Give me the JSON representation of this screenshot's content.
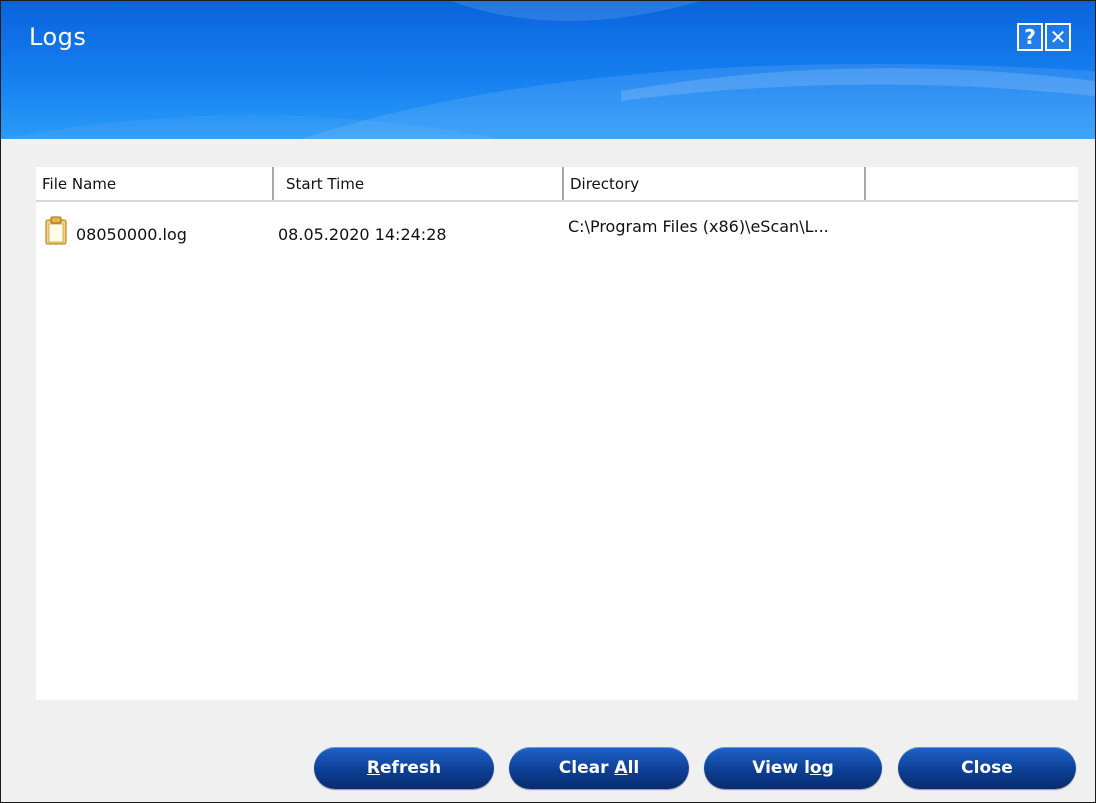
{
  "window": {
    "title": "Logs",
    "help_glyph": "?",
    "close_glyph": "✕"
  },
  "list": {
    "columns": [
      "File Name",
      "Start Time",
      "Directory",
      ""
    ],
    "rows": [
      {
        "icon": "log-file-icon",
        "file_name": "08050000.log",
        "start_time": "08.05.2020 14:24:28",
        "directory": "C:\\Program Files (x86)\\eScan\\L..."
      }
    ]
  },
  "buttons": {
    "refresh": {
      "mnemonic": "R",
      "rest": "efresh"
    },
    "clear_all": {
      "prefix": "Clear ",
      "mnemonic": "A",
      "rest": "ll"
    },
    "view_log": {
      "prefix": "View l",
      "mnemonic": "o",
      "rest": "g"
    },
    "close": {
      "label": "Close"
    }
  },
  "colors": {
    "titlebar": "#157ff0",
    "button": "#0d3f95",
    "background": "#f0f0f0"
  }
}
